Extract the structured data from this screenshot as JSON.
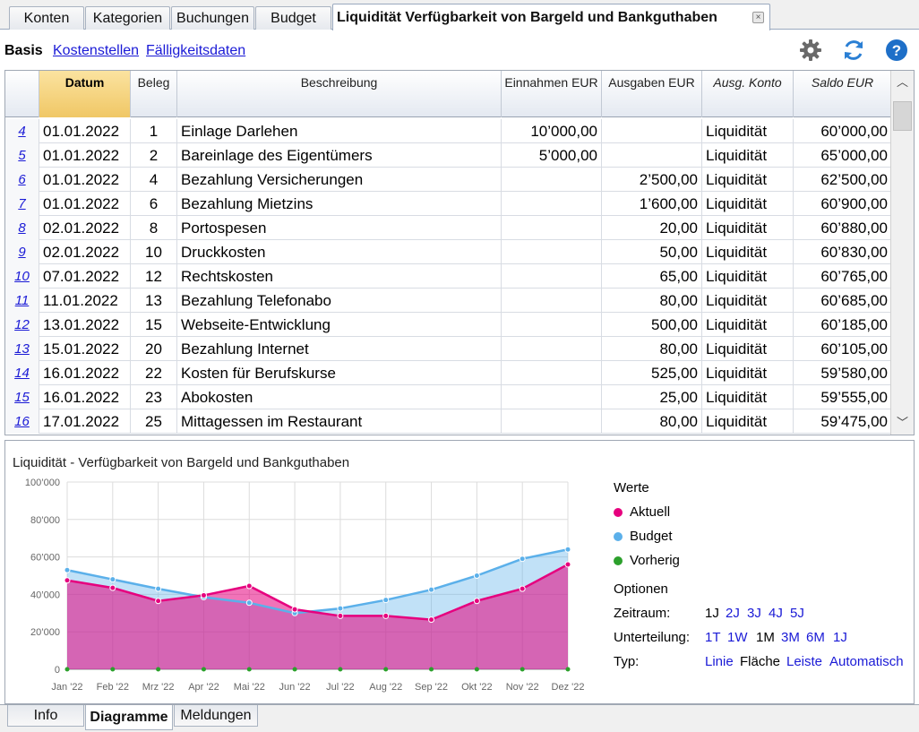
{
  "tabs": [
    {
      "label": "Konten"
    },
    {
      "label": "Kategorien"
    },
    {
      "label": "Buchungen"
    },
    {
      "label": "Budget"
    },
    {
      "label": "Liquidität Verfügbarkeit von Bargeld und Bankguthaben",
      "close": "×"
    }
  ],
  "views": {
    "active": "Basis",
    "links": [
      "Kostenstellen",
      "Fälligkeitsdaten"
    ]
  },
  "toolbar": {
    "settings_icon": "gear-icon",
    "refresh_icon": "refresh-icon",
    "help_icon": "help-icon",
    "accent": "#1e6fc8"
  },
  "table": {
    "headers": [
      "Datum",
      "Beleg",
      "Beschreibung",
      "Einnahmen EUR",
      "Ausgaben EUR",
      "Ausg. Konto",
      "Saldo EUR"
    ],
    "rows": [
      {
        "n": "4",
        "datum": "01.01.2022",
        "beleg": "1",
        "beschreibung": "Einlage Darlehen",
        "einnahmen": "10’000,00",
        "ausgaben": "",
        "konto": "Liquidität",
        "saldo": "60’000,00"
      },
      {
        "n": "5",
        "datum": "01.01.2022",
        "beleg": "2",
        "beschreibung": "Bareinlage des Eigentümers",
        "einnahmen": "5’000,00",
        "ausgaben": "",
        "konto": "Liquidität",
        "saldo": "65’000,00"
      },
      {
        "n": "6",
        "datum": "01.01.2022",
        "beleg": "4",
        "beschreibung": "Bezahlung Versicherungen",
        "einnahmen": "",
        "ausgaben": "2’500,00",
        "konto": "Liquidität",
        "saldo": "62’500,00"
      },
      {
        "n": "7",
        "datum": "01.01.2022",
        "beleg": "6",
        "beschreibung": "Bezahlung Mietzins",
        "einnahmen": "",
        "ausgaben": "1’600,00",
        "konto": "Liquidität",
        "saldo": "60’900,00"
      },
      {
        "n": "8",
        "datum": "02.01.2022",
        "beleg": "8",
        "beschreibung": "Portospesen",
        "einnahmen": "",
        "ausgaben": "20,00",
        "konto": "Liquidität",
        "saldo": "60’880,00"
      },
      {
        "n": "9",
        "datum": "02.01.2022",
        "beleg": "10",
        "beschreibung": "Druckkosten",
        "einnahmen": "",
        "ausgaben": "50,00",
        "konto": "Liquidität",
        "saldo": "60’830,00"
      },
      {
        "n": "10",
        "datum": "07.01.2022",
        "beleg": "12",
        "beschreibung": "Rechtskosten",
        "einnahmen": "",
        "ausgaben": "65,00",
        "konto": "Liquidität",
        "saldo": "60’765,00"
      },
      {
        "n": "11",
        "datum": "11.01.2022",
        "beleg": "13",
        "beschreibung": "Bezahlung Telefonabo",
        "einnahmen": "",
        "ausgaben": "80,00",
        "konto": "Liquidität",
        "saldo": "60’685,00"
      },
      {
        "n": "12",
        "datum": "13.01.2022",
        "beleg": "15",
        "beschreibung": "Webseite-Entwicklung",
        "einnahmen": "",
        "ausgaben": "500,00",
        "konto": "Liquidität",
        "saldo": "60’185,00"
      },
      {
        "n": "13",
        "datum": "15.01.2022",
        "beleg": "20",
        "beschreibung": "Bezahlung Internet",
        "einnahmen": "",
        "ausgaben": "80,00",
        "konto": "Liquidität",
        "saldo": "60’105,00"
      },
      {
        "n": "14",
        "datum": "16.01.2022",
        "beleg": "22",
        "beschreibung": "Kosten für Berufskurse",
        "einnahmen": "",
        "ausgaben": "525,00",
        "konto": "Liquidität",
        "saldo": "59’580,00"
      },
      {
        "n": "15",
        "datum": "16.01.2022",
        "beleg": "23",
        "beschreibung": "Abokosten",
        "einnahmen": "",
        "ausgaben": "25,00",
        "konto": "Liquidität",
        "saldo": "59’555,00"
      },
      {
        "n": "16",
        "datum": "17.01.2022",
        "beleg": "25",
        "beschreibung": "Mittagessen im Restaurant",
        "einnahmen": "",
        "ausgaben": "80,00",
        "konto": "Liquidität",
        "saldo": "59’475,00"
      }
    ]
  },
  "chart_data": {
    "type": "area",
    "title": "Liquidität - Verfügbarkeit von Bargeld und Bankguthaben",
    "categories": [
      "Jan '22",
      "Feb '22",
      "Mrz '22",
      "Apr '22",
      "Mai '22",
      "Jun '22",
      "Jul '22",
      "Aug '22",
      "Sep '22",
      "Okt '22",
      "Nov '22",
      "Dez '22"
    ],
    "yticks": [
      "0",
      "20’000",
      "40’000",
      "60’000",
      "80’000",
      "100’000"
    ],
    "ylim": [
      0,
      100000
    ],
    "grid": true,
    "series": [
      {
        "name": "Aktuell",
        "color": "#e6007e",
        "values": [
          47500,
          43500,
          36500,
          39500,
          44500,
          32000,
          28500,
          28500,
          26500,
          36500,
          43000,
          56000
        ]
      },
      {
        "name": "Budget",
        "color": "#5bb0ea",
        "values": [
          53000,
          48000,
          43000,
          38500,
          35500,
          30000,
          32500,
          37000,
          42500,
          50000,
          59000,
          64000
        ]
      },
      {
        "name": "Vorherig",
        "color": "#2ca02c",
        "values": [
          0,
          0,
          0,
          0,
          0,
          0,
          0,
          0,
          0,
          0,
          0,
          0
        ]
      }
    ],
    "legend_position": "right"
  },
  "legend": {
    "title": "Werte",
    "items": [
      "Aktuell",
      "Budget",
      "Vorherig"
    ]
  },
  "options": {
    "title": "Optionen",
    "zeitraum": {
      "label": "Zeitraum:",
      "values": [
        "1J",
        "2J",
        "3J",
        "4J",
        "5J"
      ],
      "selected": "1J"
    },
    "unterteilung": {
      "label": "Unterteilung:",
      "values": [
        "1T",
        "1W",
        "1M",
        "3M",
        "6M",
        "1J"
      ],
      "selected": "1M"
    },
    "typ": {
      "label": "Typ:",
      "values": [
        "Linie",
        "Fläche",
        "Leiste",
        "Automatisch"
      ],
      "selected": "Fläche"
    }
  },
  "bottom_tabs": [
    {
      "label": "Info"
    },
    {
      "label": "Diagramme"
    },
    {
      "label": "Meldungen"
    }
  ],
  "colors": {
    "link": "#1a1ad6",
    "datum_header": "#f0c765"
  }
}
